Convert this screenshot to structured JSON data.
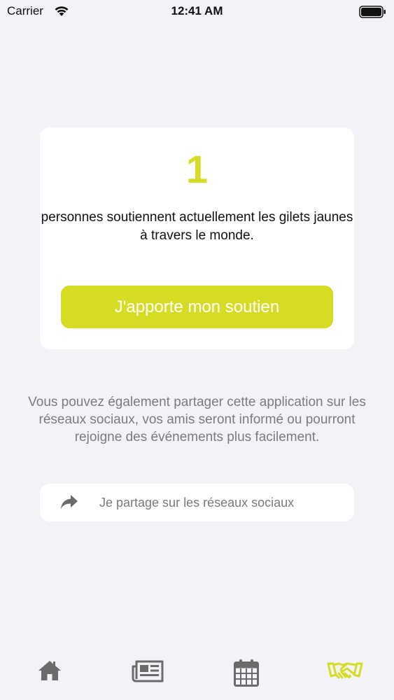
{
  "status_bar": {
    "carrier": "Carrier",
    "time": "12:41 AM"
  },
  "support_card": {
    "count": "1",
    "text": "personnes soutiennent actuellement les gilets jaunes à travers le monde.",
    "button_label": "J'apporte mon soutien"
  },
  "share": {
    "info": "Vous pouvez également partager cette application sur les réseaux sociaux, vos amis seront informé ou pourront rejoigne des événements plus facilement.",
    "button_label": "Je partage sur les réseaux sociaux",
    "icon": "share-arrow-icon"
  },
  "tab_bar": {
    "items": [
      {
        "icon": "home-icon",
        "active": false
      },
      {
        "icon": "newspaper-icon",
        "active": false
      },
      {
        "icon": "calendar-icon",
        "active": false
      },
      {
        "icon": "handshake-icon",
        "active": true
      }
    ]
  },
  "colors": {
    "accent": "#d6dc23",
    "background": "#f3f2f7",
    "card": "#ffffff",
    "muted_text": "#7c7c7c",
    "inactive_icon": "#6b6b6b"
  }
}
